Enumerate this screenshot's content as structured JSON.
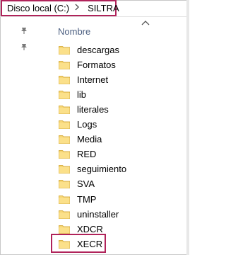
{
  "breadcrumb": {
    "items": [
      "Disco local (C:)",
      "SILTRA"
    ]
  },
  "list_header": {
    "name_column": "Nombre"
  },
  "folders": [
    "descargas",
    "Formatos",
    "Internet",
    "lib",
    "literales",
    "Logs",
    "Media",
    "RED",
    "seguimiento",
    "SVA",
    "TMP",
    "uninstaller",
    "XDCR",
    "XECR"
  ],
  "colors": {
    "highlight": "#b0235a",
    "header_text": "#4d6082",
    "folder_fill": "#f7d674"
  }
}
